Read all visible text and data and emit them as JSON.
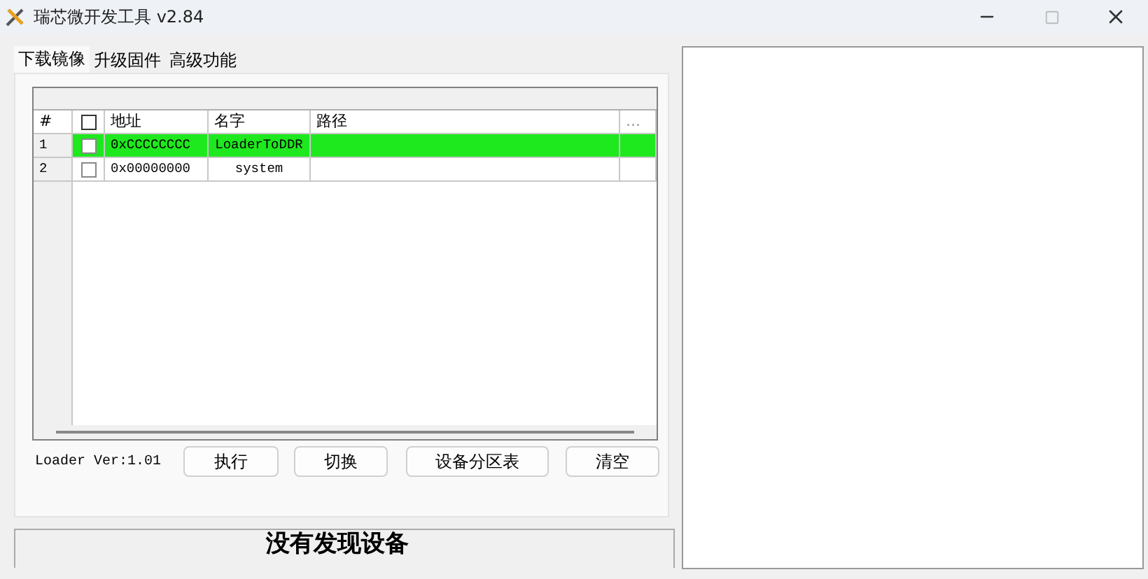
{
  "window": {
    "title": "瑞芯微开发工具 v2.84"
  },
  "tabs": [
    {
      "label": "下载镜像",
      "selected": true
    },
    {
      "label": "升级固件",
      "selected": false
    },
    {
      "label": "高级功能",
      "selected": false
    }
  ],
  "table": {
    "columns": [
      "#",
      "地址",
      "名字",
      "路径",
      "..."
    ],
    "header_checkbox": {
      "checked": false
    },
    "rows": [
      {
        "index": "1",
        "checked": false,
        "address": "0xCCCCCCCC",
        "name": "LoaderToDDR",
        "selected": true
      },
      {
        "index": "2",
        "checked": false,
        "address": "0x00000000",
        "name": "system",
        "selected": false
      }
    ]
  },
  "loader_version": "Loader Ver:1.01",
  "buttons": [
    "执行",
    "切换",
    "设备分区表",
    "清空"
  ],
  "status_bar": "没有发现设备"
}
